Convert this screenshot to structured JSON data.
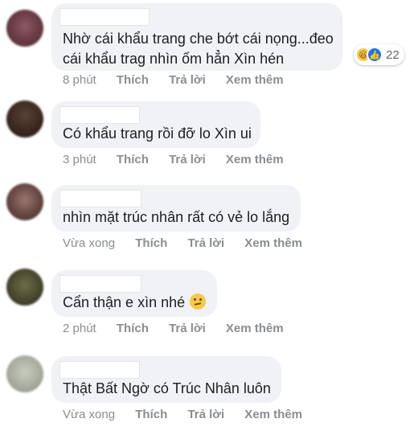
{
  "colors": {
    "bubble": "#f0f2f5",
    "meta_text": "#8a8d91",
    "like_blue": "#1877f2",
    "haha_yellow": "#f7c84a"
  },
  "comments": [
    {
      "lines": [
        "Nhờ cái khẩu trang che bớt cái nọng...đeo",
        "cái khẩu trag nhìn ốm hẳn Xìn hén"
      ],
      "time": "8 phút",
      "like": "Thích",
      "reply": "Trả lời",
      "more": "Xem thêm",
      "reactions": {
        "icons": [
          "haha-icon",
          "like-icon"
        ],
        "count": "22"
      }
    },
    {
      "lines": [
        "Có khẩu trang rồi đỡ lo Xìn ui"
      ],
      "time": "3 phút",
      "like": "Thích",
      "reply": "Trả lời",
      "more": "Xem thêm"
    },
    {
      "lines": [
        "nhìn mặt trúc nhân rất có vẻ lo lắng"
      ],
      "time": "Vừa xong",
      "like": "Thích",
      "reply": "Trả lời",
      "more": "Xem thêm"
    },
    {
      "lines": [
        "Cẩn thận e xìn nhé"
      ],
      "emoji": "thinking-face-icon",
      "time": "2 phút",
      "like": "Thích",
      "reply": "Trả lời",
      "more": "Xem thêm"
    },
    {
      "lines": [
        "Thật Bất Ngờ có Trúc Nhân luôn"
      ],
      "time": "Vừa xong",
      "like": "Thích",
      "reply": "Trả lời",
      "more": "Xem thêm"
    }
  ]
}
